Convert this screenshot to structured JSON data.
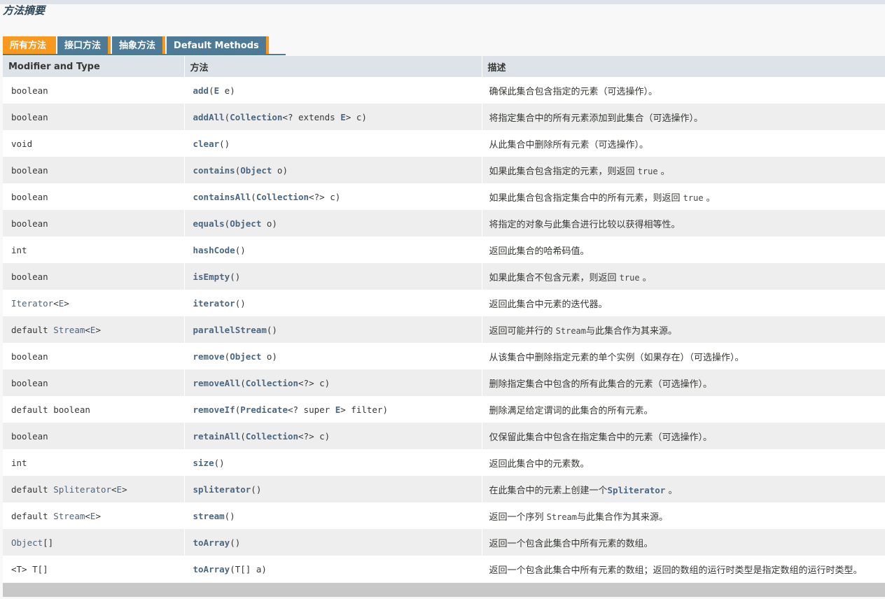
{
  "section_title": "方法摘要",
  "tabs": [
    {
      "label": "所有方法",
      "active": true
    },
    {
      "label": "接口方法",
      "active": false
    },
    {
      "label": "抽象方法",
      "active": false
    },
    {
      "label": "Default Methods",
      "active": false
    }
  ],
  "columns": {
    "modifier": "Modifier and Type",
    "method": "方法",
    "description": "描述"
  },
  "colors": {
    "tab_active": "#f8981d",
    "tab_inactive": "#4d7a97",
    "header_bg": "#dee3e9",
    "link": "#4a6782",
    "row_alt": "#eeeeef"
  },
  "rows": [
    {
      "type": [
        {
          "t": "boolean",
          "link": false
        }
      ],
      "method": [
        {
          "t": "add",
          "link": true
        },
        {
          "t": "(",
          "link": false
        },
        {
          "t": "E",
          "link": true
        },
        {
          "t": " e)",
          "link": false
        }
      ],
      "desc": [
        {
          "t": "确保此集合包含指定的元素（可选操作）。",
          "code": false
        }
      ]
    },
    {
      "type": [
        {
          "t": "boolean",
          "link": false
        }
      ],
      "method": [
        {
          "t": "addAll",
          "link": true
        },
        {
          "t": "(",
          "link": false
        },
        {
          "t": "Collection",
          "link": true
        },
        {
          "t": "<? extends ",
          "link": false
        },
        {
          "t": "E",
          "link": true
        },
        {
          "t": "> c)",
          "link": false
        }
      ],
      "desc": [
        {
          "t": "将指定集合中的所有元素添加到此集合（可选操作）。",
          "code": false
        }
      ]
    },
    {
      "type": [
        {
          "t": "void",
          "link": false
        }
      ],
      "method": [
        {
          "t": "clear",
          "link": true
        },
        {
          "t": "()",
          "link": false
        }
      ],
      "desc": [
        {
          "t": "从此集合中删除所有元素（可选操作）。",
          "code": false
        }
      ]
    },
    {
      "type": [
        {
          "t": "boolean",
          "link": false
        }
      ],
      "method": [
        {
          "t": "contains",
          "link": true
        },
        {
          "t": "(",
          "link": false
        },
        {
          "t": "Object",
          "link": true
        },
        {
          "t": " o)",
          "link": false
        }
      ],
      "desc": [
        {
          "t": "如果此集合包含指定的元素，则返回 ",
          "code": false
        },
        {
          "t": "true",
          "code": true
        },
        {
          "t": " 。",
          "code": false
        }
      ]
    },
    {
      "type": [
        {
          "t": "boolean",
          "link": false
        }
      ],
      "method": [
        {
          "t": "containsAll",
          "link": true
        },
        {
          "t": "(",
          "link": false
        },
        {
          "t": "Collection",
          "link": true
        },
        {
          "t": "<?> c)",
          "link": false
        }
      ],
      "desc": [
        {
          "t": "如果此集合包含指定集合中的所有元素，则返回 ",
          "code": false
        },
        {
          "t": "true",
          "code": true
        },
        {
          "t": " 。",
          "code": false
        }
      ]
    },
    {
      "type": [
        {
          "t": "boolean",
          "link": false
        }
      ],
      "method": [
        {
          "t": "equals",
          "link": true
        },
        {
          "t": "(",
          "link": false
        },
        {
          "t": "Object",
          "link": true
        },
        {
          "t": " o)",
          "link": false
        }
      ],
      "desc": [
        {
          "t": "将指定的对象与此集合进行比较以获得相等性。",
          "code": false
        }
      ]
    },
    {
      "type": [
        {
          "t": "int",
          "link": false
        }
      ],
      "method": [
        {
          "t": "hashCode",
          "link": true
        },
        {
          "t": "()",
          "link": false
        }
      ],
      "desc": [
        {
          "t": "返回此集合的哈希码值。",
          "code": false
        }
      ]
    },
    {
      "type": [
        {
          "t": "boolean",
          "link": false
        }
      ],
      "method": [
        {
          "t": "isEmpty",
          "link": true
        },
        {
          "t": "()",
          "link": false
        }
      ],
      "desc": [
        {
          "t": "如果此集合不包含元素，则返回 ",
          "code": false
        },
        {
          "t": "true",
          "code": true
        },
        {
          "t": " 。",
          "code": false
        }
      ]
    },
    {
      "type": [
        {
          "t": "Iterator",
          "link": true
        },
        {
          "t": "<",
          "link": false
        },
        {
          "t": "E",
          "link": true
        },
        {
          "t": ">",
          "link": false
        }
      ],
      "method": [
        {
          "t": "iterator",
          "link": true
        },
        {
          "t": "()",
          "link": false
        }
      ],
      "desc": [
        {
          "t": "返回此集合中元素的迭代器。",
          "code": false
        }
      ]
    },
    {
      "type": [
        {
          "t": "default ",
          "link": false
        },
        {
          "t": "Stream",
          "link": true
        },
        {
          "t": "<",
          "link": false
        },
        {
          "t": "E",
          "link": true
        },
        {
          "t": ">",
          "link": false
        }
      ],
      "method": [
        {
          "t": "parallelStream",
          "link": true
        },
        {
          "t": "()",
          "link": false
        }
      ],
      "desc": [
        {
          "t": "返回可能并行的 ",
          "code": false
        },
        {
          "t": "Stream",
          "code": true
        },
        {
          "t": "与此集合作为其来源。",
          "code": false
        }
      ]
    },
    {
      "type": [
        {
          "t": "boolean",
          "link": false
        }
      ],
      "method": [
        {
          "t": "remove",
          "link": true
        },
        {
          "t": "(",
          "link": false
        },
        {
          "t": "Object",
          "link": true
        },
        {
          "t": " o)",
          "link": false
        }
      ],
      "desc": [
        {
          "t": "从该集合中删除指定元素的单个实例（如果存在）（可选操作）。",
          "code": false
        }
      ]
    },
    {
      "type": [
        {
          "t": "boolean",
          "link": false
        }
      ],
      "method": [
        {
          "t": "removeAll",
          "link": true
        },
        {
          "t": "(",
          "link": false
        },
        {
          "t": "Collection",
          "link": true
        },
        {
          "t": "<?> c)",
          "link": false
        }
      ],
      "desc": [
        {
          "t": "删除指定集合中包含的所有此集合的元素（可选操作）。",
          "code": false
        }
      ]
    },
    {
      "type": [
        {
          "t": "default boolean",
          "link": false
        }
      ],
      "method": [
        {
          "t": "removeIf",
          "link": true
        },
        {
          "t": "(",
          "link": false
        },
        {
          "t": "Predicate",
          "link": true
        },
        {
          "t": "<? super ",
          "link": false
        },
        {
          "t": "E",
          "link": true
        },
        {
          "t": "> filter)",
          "link": false
        }
      ],
      "desc": [
        {
          "t": "删除满足给定谓词的此集合的所有元素。",
          "code": false
        }
      ]
    },
    {
      "type": [
        {
          "t": "boolean",
          "link": false
        }
      ],
      "method": [
        {
          "t": "retainAll",
          "link": true
        },
        {
          "t": "(",
          "link": false
        },
        {
          "t": "Collection",
          "link": true
        },
        {
          "t": "<?> c)",
          "link": false
        }
      ],
      "desc": [
        {
          "t": "仅保留此集合中包含在指定集合中的元素（可选操作）。",
          "code": false
        }
      ]
    },
    {
      "type": [
        {
          "t": "int",
          "link": false
        }
      ],
      "method": [
        {
          "t": "size",
          "link": true
        },
        {
          "t": "()",
          "link": false
        }
      ],
      "desc": [
        {
          "t": "返回此集合中的元素数。",
          "code": false
        }
      ]
    },
    {
      "type": [
        {
          "t": "default ",
          "link": false
        },
        {
          "t": "Spliterator",
          "link": true
        },
        {
          "t": "<",
          "link": false
        },
        {
          "t": "E",
          "link": true
        },
        {
          "t": ">",
          "link": false
        }
      ],
      "method": [
        {
          "t": "spliterator",
          "link": true
        },
        {
          "t": "()",
          "link": false
        }
      ],
      "desc": [
        {
          "t": "在此集合中的元素上创建一个",
          "code": false
        },
        {
          "t": "Spliterator",
          "code": "link"
        },
        {
          "t": " 。",
          "code": false
        }
      ]
    },
    {
      "type": [
        {
          "t": "default ",
          "link": false
        },
        {
          "t": "Stream",
          "link": true
        },
        {
          "t": "<",
          "link": false
        },
        {
          "t": "E",
          "link": true
        },
        {
          "t": ">",
          "link": false
        }
      ],
      "method": [
        {
          "t": "stream",
          "link": true
        },
        {
          "t": "()",
          "link": false
        }
      ],
      "desc": [
        {
          "t": "返回一个序列 ",
          "code": false
        },
        {
          "t": "Stream",
          "code": true
        },
        {
          "t": "与此集合作为其来源。",
          "code": false
        }
      ]
    },
    {
      "type": [
        {
          "t": "Object",
          "link": true
        },
        {
          "t": "[]",
          "link": false
        }
      ],
      "method": [
        {
          "t": "toArray",
          "link": true
        },
        {
          "t": "()",
          "link": false
        }
      ],
      "desc": [
        {
          "t": "返回一个包含此集合中所有元素的数组。",
          "code": false
        }
      ]
    },
    {
      "type": [
        {
          "t": "<T> T[]",
          "link": false
        }
      ],
      "method": [
        {
          "t": "toArray",
          "link": true
        },
        {
          "t": "(T[] a)",
          "link": false
        }
      ],
      "desc": [
        {
          "t": "返回一个包含此集合中所有元素的数组；返回的数组的运行时类型是指定数组的运行时类型。",
          "code": false
        }
      ]
    }
  ]
}
